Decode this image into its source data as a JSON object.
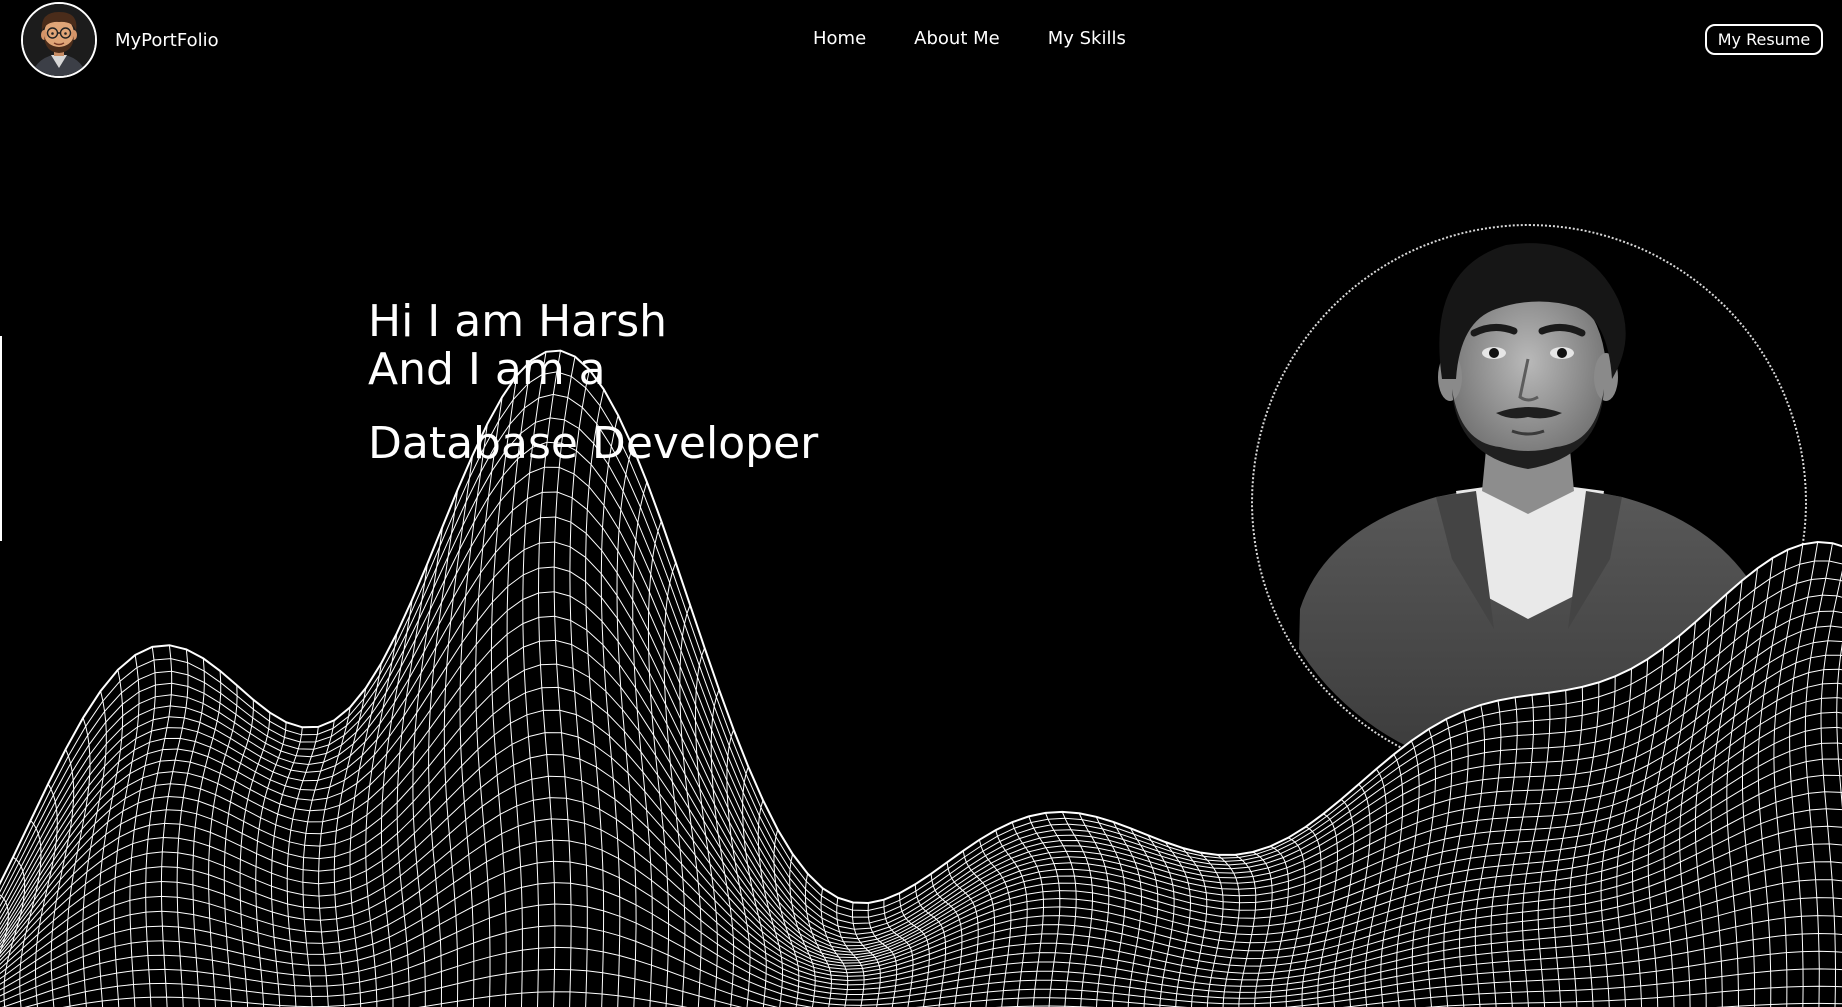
{
  "nav": {
    "brand": "MyPortFolio",
    "links": [
      "Home",
      "About Me",
      "My Skills"
    ],
    "resume_label": "My Resume"
  },
  "hero": {
    "greeting": "Hi I am Harsh",
    "intro": "And I am a",
    "role": "Database Developer"
  },
  "colors": {
    "background": "#000000",
    "text": "#ffffff",
    "wireframe": "#ffffff"
  },
  "icons": {
    "brand_avatar": "cartoon-avatar-icon",
    "portrait": "profile-photo"
  }
}
